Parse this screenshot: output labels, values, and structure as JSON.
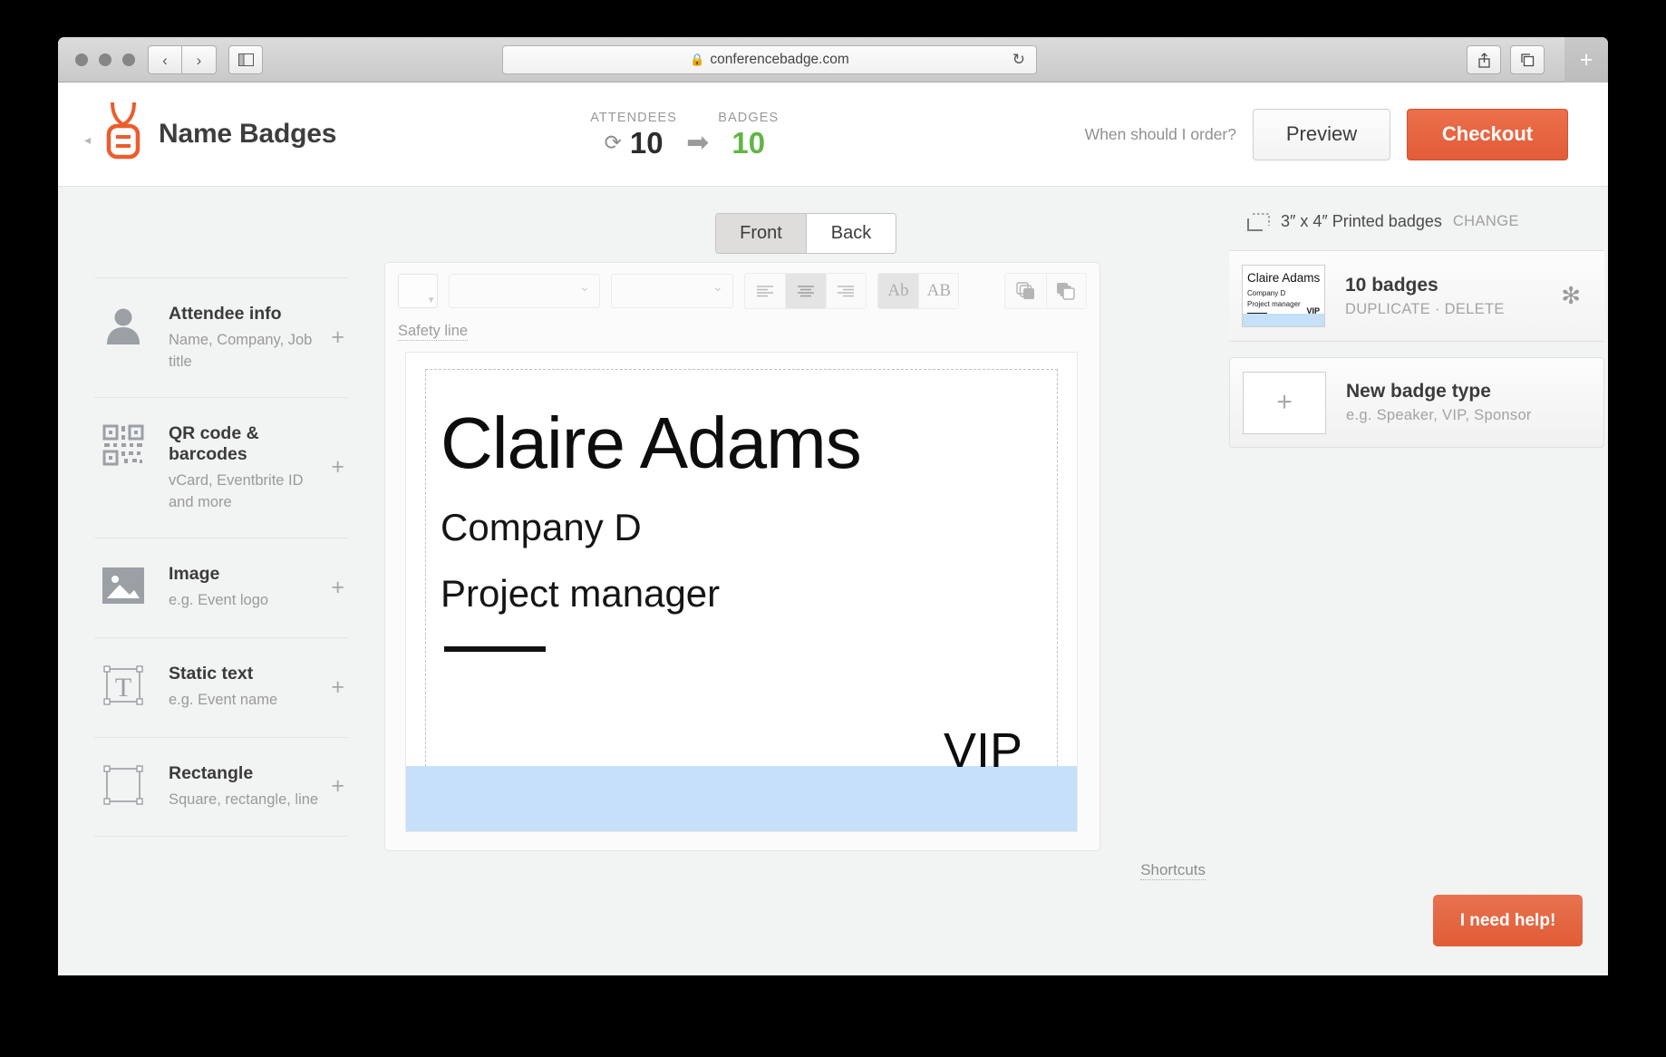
{
  "browser": {
    "url": "conferencebadge.com",
    "lock_icon": "lock-icon",
    "back_icon": "chevron-left-icon",
    "forward_icon": "chevron-right-icon",
    "sidebar_icon": "sidebar-toggle-icon",
    "reload_icon": "reload-icon",
    "share_icon": "share-icon",
    "tabs_icon": "show-tabs-icon",
    "new_tab_label": "+"
  },
  "header": {
    "brand_title": "Name Badges",
    "logo_icon": "badge-lanyard-logo",
    "collapse_icon": "chevron-left-icon",
    "attendees_label": "ATTENDEES",
    "attendees_value": "10",
    "badges_label": "BADGES",
    "badges_value": "10",
    "sync_icon": "sync-icon",
    "arrow_icon": "arrow-right-icon",
    "when_order_link": "When should I order?",
    "preview_label": "Preview",
    "checkout_label": "Checkout",
    "accent_color": "#e25c38",
    "badges_count_color": "#62b544"
  },
  "sidebar": {
    "items": [
      {
        "title": "Attendee info",
        "subtitle": "Name, Company, Job title",
        "icon": "person-icon",
        "add_label": "+"
      },
      {
        "title": "QR code & barcodes",
        "subtitle": "vCard, Eventbrite ID and more",
        "icon": "qr-code-icon",
        "add_label": "+"
      },
      {
        "title": "Image",
        "subtitle": "e.g. Event logo",
        "icon": "image-icon",
        "add_label": "+"
      },
      {
        "title": "Static text",
        "subtitle": "e.g. Event name",
        "icon": "text-box-icon",
        "add_label": "+"
      },
      {
        "title": "Rectangle",
        "subtitle": "Square, rectangle, line",
        "icon": "rectangle-icon",
        "add_label": "+"
      }
    ]
  },
  "editor": {
    "face_tabs": [
      {
        "label": "Front",
        "active": true
      },
      {
        "label": "Back",
        "active": false
      }
    ],
    "toolbar": {
      "color_swatch_value": "",
      "font_family_value": "",
      "font_size_value": "",
      "align_left_icon": "align-left-icon",
      "align_center_icon": "align-center-icon",
      "align_right_icon": "align-right-icon",
      "case_mixed_label": "Ab",
      "case_upper_label": "AB",
      "duplicate_icon": "duplicate-filled-icon",
      "copy_icon": "copy-outline-icon"
    },
    "safety_line_label": "Safety line",
    "shortcuts_label": "Shortcuts",
    "badge": {
      "name": "Claire Adams",
      "company": "Company D",
      "job_title": "Project manager",
      "tag": "VIP",
      "bar_color": "#c5e0f8"
    }
  },
  "right_panel": {
    "size_icon": "badge-size-icon",
    "size_text": "3″ x 4″ Printed badges",
    "change_label": "CHANGE",
    "badge_type": {
      "title": "10 badges",
      "actions": "DUPLICATE · DELETE",
      "gear_icon": "gear-icon",
      "thumb": {
        "name": "Claire Adams",
        "company": "Company D",
        "job_title": "Project manager",
        "tag": "VIP"
      }
    },
    "new_badge_type": {
      "title": "New badge type",
      "subtitle": "e.g. Speaker, VIP, Sponsor",
      "add_label": "+"
    },
    "help_label": "I need help!"
  }
}
